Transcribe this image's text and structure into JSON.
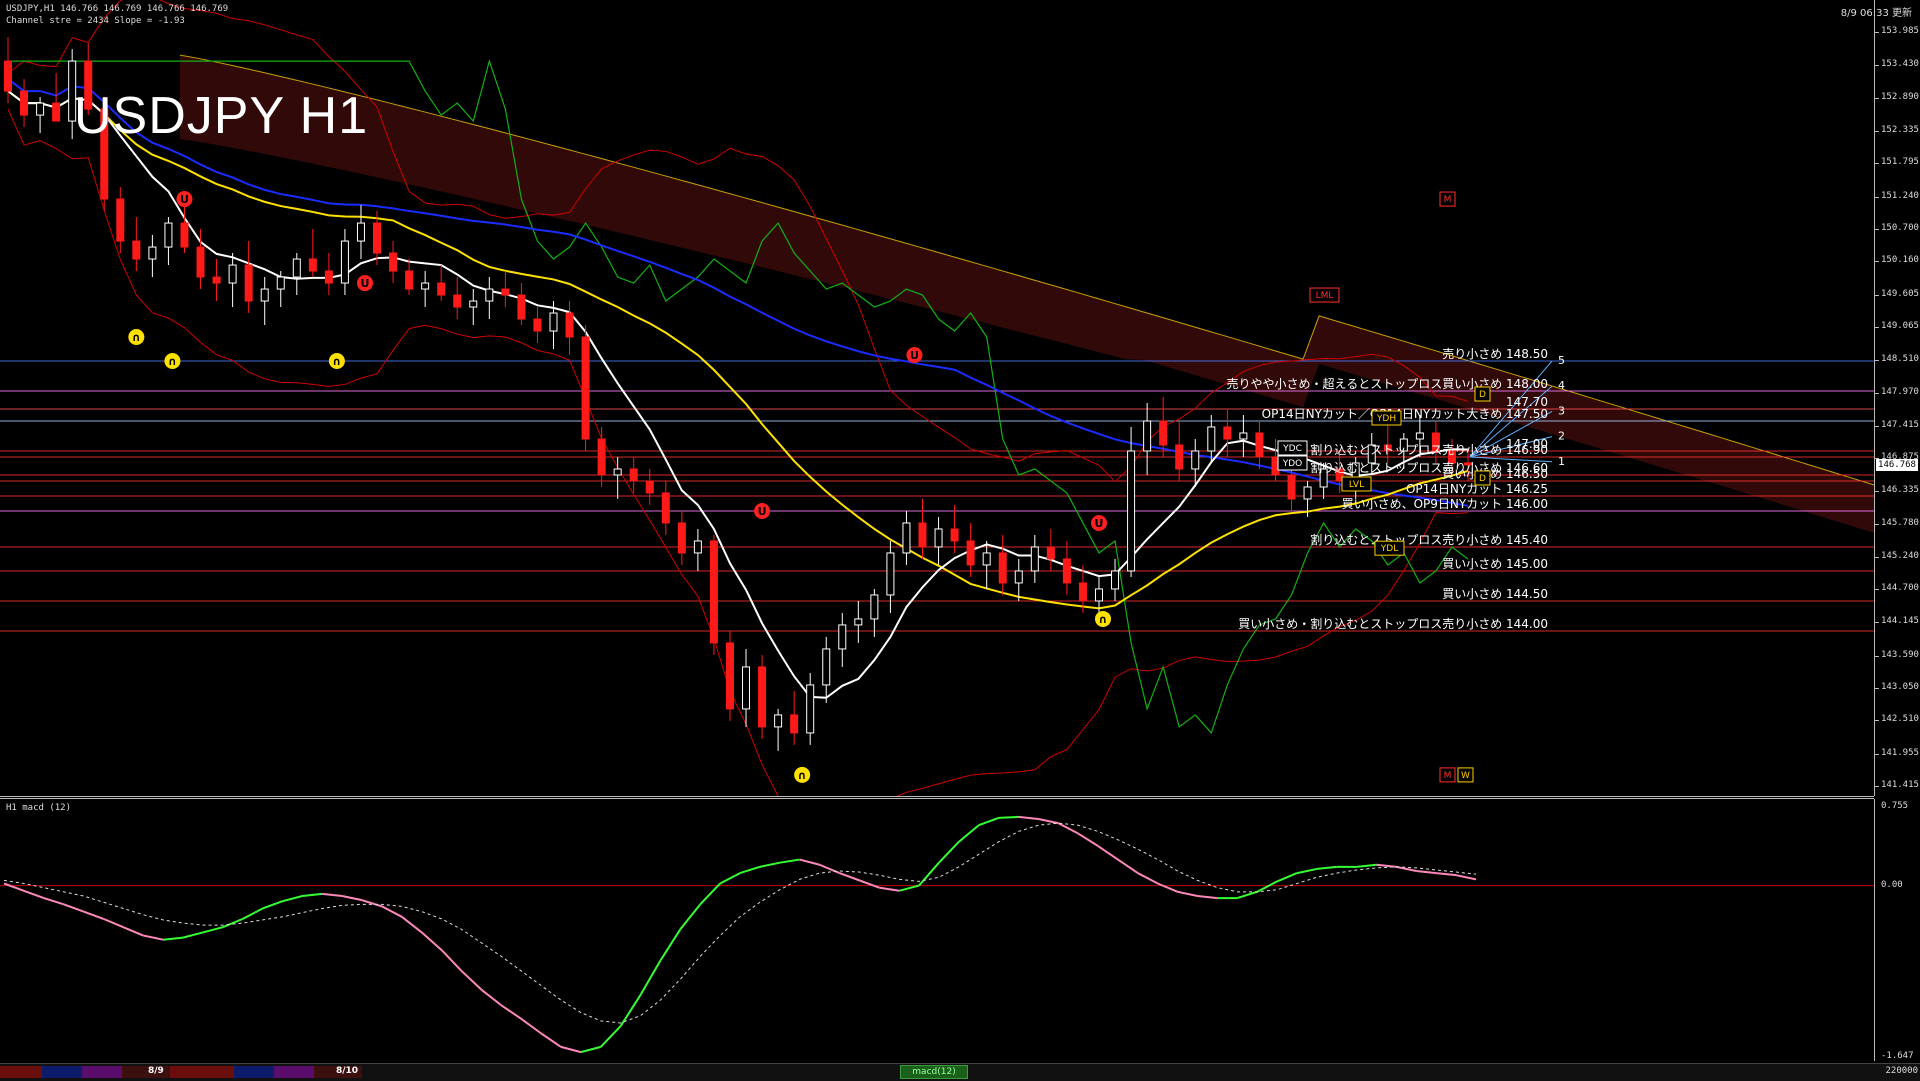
{
  "header": {
    "info_line": "USDJPY,H1  146.766 146.769 146.766 146.769",
    "channel_line": "Channel stre = 2434 Slope = -1.93",
    "datetime": "8/9 06:33 更新",
    "big_title": "USDJPY H1"
  },
  "price_axis": {
    "ticks": [
      "153.985",
      "153.430",
      "152.890",
      "152.335",
      "151.795",
      "151.240",
      "150.700",
      "150.160",
      "149.605",
      "149.065",
      "148.510",
      "147.970",
      "147.415",
      "146.875",
      "146.335",
      "145.780",
      "145.240",
      "144.700",
      "144.145",
      "143.590",
      "143.050",
      "142.510",
      "141.955",
      "141.415"
    ],
    "current_price": "146.768"
  },
  "macd_axis": {
    "ticks": [
      "0.755",
      "0.00",
      "-1.647"
    ]
  },
  "macd_label": "H1  macd (12)",
  "levels": [
    {
      "text": "売り小さめ 148.50",
      "price": 148.5,
      "color": "#4b7bff"
    },
    {
      "text": "売りやや小さめ・超えるとストップロス買い小さめ 148.00",
      "price": 148.0,
      "color": "#ff7fff"
    },
    {
      "text": "147.70",
      "price": 147.7,
      "color": "#ff5050"
    },
    {
      "text": "OP14日NYカット／OP14日NYカット大きめ 147.50",
      "price": 147.5,
      "color": "#aaccff"
    },
    {
      "text": "147.00",
      "price": 147.0,
      "color": "#ff3030"
    },
    {
      "text": "割り込むとストップロス売り小さめ 146.90",
      "price": 146.9,
      "color": "#ff3030"
    },
    {
      "text": "割り込むとストップロス売り小さめ 146.60",
      "price": 146.6,
      "color": "#ff3030"
    },
    {
      "text": "買い小さめ 146.50",
      "price": 146.5,
      "color": "#ff3030"
    },
    {
      "text": "OP14日NYカット 146.25",
      "price": 146.25,
      "color": "#ff3030"
    },
    {
      "text": "買い小さめ、OP9日NYカット 146.00",
      "price": 146.0,
      "color": "#ff7fff"
    },
    {
      "text": "割り込むとストップロス売り小さめ 145.40",
      "price": 145.4,
      "color": "#ff3030"
    },
    {
      "text": "買い小さめ 145.00",
      "price": 145.0,
      "color": "#ff3030"
    },
    {
      "text": "買い小さめ 144.50",
      "price": 144.5,
      "color": "#ff3030"
    },
    {
      "text": "買い小さめ・割り込むとストップロス売り小さめ 144.00",
      "price": 144.0,
      "color": "#ff3030"
    }
  ],
  "tags": [
    {
      "text": "M",
      "price": 151.2,
      "color": "#ff3030"
    },
    {
      "text": "LML",
      "price": 149.6,
      "color": "#ff3030"
    },
    {
      "text": "YDH",
      "price": 147.55,
      "color": "#ffd000"
    },
    {
      "text": "YDC",
      "price": 147.05,
      "color": "#ffffff"
    },
    {
      "text": "YDO",
      "price": 146.8,
      "color": "#ffffff"
    },
    {
      "text": "LVL",
      "price": 146.45,
      "color": "#ffd000"
    },
    {
      "text": "YDL",
      "price": 145.38,
      "color": "#ffd000"
    },
    {
      "text": "M",
      "price": 141.6,
      "color": "#ff3030"
    },
    {
      "text": "W",
      "price": 141.6,
      "color": "#ffd000"
    },
    {
      "text": "D",
      "price": 147.95,
      "color": "#ffd000"
    },
    {
      "text": "D",
      "price": 146.55,
      "color": "#ffd000"
    }
  ],
  "fan_numbers": [
    "5",
    "4",
    "3",
    "2",
    "1"
  ],
  "bottom_strip": {
    "dates": [
      "8/9",
      "8/10"
    ],
    "macd_tab": "macd(12)",
    "right_text": "220000"
  },
  "chart_data": {
    "type": "candlestick",
    "title": "USDJPY H1",
    "ylim": [
      141.415,
      153.985
    ],
    "candles": [
      [
        153.5,
        153.9,
        152.8,
        153.0
      ],
      [
        153.0,
        153.2,
        152.4,
        152.6
      ],
      [
        152.6,
        152.9,
        152.3,
        152.8
      ],
      [
        152.8,
        153.3,
        152.5,
        152.5
      ],
      [
        152.5,
        153.7,
        152.2,
        153.5
      ],
      [
        153.5,
        153.8,
        152.6,
        152.7
      ],
      [
        152.7,
        152.9,
        151.0,
        151.2
      ],
      [
        151.2,
        151.4,
        150.3,
        150.5
      ],
      [
        150.5,
        150.9,
        150.0,
        150.2
      ],
      [
        150.2,
        150.6,
        149.9,
        150.4
      ],
      [
        150.4,
        150.9,
        150.1,
        150.8
      ],
      [
        150.8,
        151.1,
        150.3,
        150.4
      ],
      [
        150.4,
        150.7,
        149.7,
        149.9
      ],
      [
        149.9,
        150.2,
        149.5,
        149.8
      ],
      [
        149.8,
        150.3,
        149.4,
        150.1
      ],
      [
        150.1,
        150.5,
        149.3,
        149.5
      ],
      [
        149.5,
        149.9,
        149.1,
        149.7
      ],
      [
        149.7,
        150.0,
        149.4,
        149.9
      ],
      [
        149.9,
        150.3,
        149.6,
        150.2
      ],
      [
        150.2,
        150.7,
        149.9,
        150.0
      ],
      [
        150.0,
        150.3,
        149.6,
        149.8
      ],
      [
        149.8,
        150.7,
        149.6,
        150.5
      ],
      [
        150.5,
        151.1,
        150.2,
        150.8
      ],
      [
        150.8,
        151.0,
        150.1,
        150.3
      ],
      [
        150.3,
        150.5,
        149.8,
        150.0
      ],
      [
        150.0,
        150.2,
        149.6,
        149.7
      ],
      [
        149.7,
        150.0,
        149.4,
        149.8
      ],
      [
        149.8,
        150.1,
        149.5,
        149.6
      ],
      [
        149.6,
        149.9,
        149.2,
        149.4
      ],
      [
        149.4,
        149.7,
        149.1,
        149.5
      ],
      [
        149.5,
        149.9,
        149.2,
        149.7
      ],
      [
        149.7,
        150.0,
        149.4,
        149.6
      ],
      [
        149.6,
        149.8,
        149.1,
        149.2
      ],
      [
        149.2,
        149.4,
        148.8,
        149.0
      ],
      [
        149.0,
        149.5,
        148.7,
        149.3
      ],
      [
        149.3,
        149.5,
        148.6,
        148.9
      ],
      [
        148.9,
        149.1,
        147.0,
        147.2
      ],
      [
        147.2,
        147.4,
        146.4,
        146.6
      ],
      [
        146.6,
        146.9,
        146.2,
        146.7
      ],
      [
        146.7,
        146.9,
        146.3,
        146.5
      ],
      [
        146.5,
        146.7,
        146.1,
        146.3
      ],
      [
        146.3,
        146.5,
        145.6,
        145.8
      ],
      [
        145.8,
        146.0,
        145.1,
        145.3
      ],
      [
        145.3,
        145.7,
        145.0,
        145.5
      ],
      [
        145.5,
        145.6,
        143.6,
        143.8
      ],
      [
        143.8,
        144.0,
        142.5,
        142.7
      ],
      [
        142.7,
        143.7,
        142.4,
        143.4
      ],
      [
        143.4,
        143.6,
        142.2,
        142.4
      ],
      [
        142.4,
        142.7,
        142.0,
        142.6
      ],
      [
        142.6,
        143.0,
        142.1,
        142.3
      ],
      [
        142.3,
        143.3,
        142.1,
        143.1
      ],
      [
        143.1,
        143.9,
        142.8,
        143.7
      ],
      [
        143.7,
        144.3,
        143.4,
        144.1
      ],
      [
        144.1,
        144.5,
        143.8,
        144.2
      ],
      [
        144.2,
        144.7,
        143.9,
        144.6
      ],
      [
        144.6,
        145.5,
        144.3,
        145.3
      ],
      [
        145.3,
        146.0,
        145.1,
        145.8
      ],
      [
        145.8,
        146.2,
        145.2,
        145.4
      ],
      [
        145.4,
        145.9,
        145.1,
        145.7
      ],
      [
        145.7,
        146.1,
        145.3,
        145.5
      ],
      [
        145.5,
        145.8,
        144.9,
        145.1
      ],
      [
        145.1,
        145.5,
        144.7,
        145.3
      ],
      [
        145.3,
        145.6,
        144.6,
        144.8
      ],
      [
        144.8,
        145.2,
        144.5,
        145.0
      ],
      [
        145.0,
        145.6,
        144.8,
        145.4
      ],
      [
        145.4,
        145.7,
        145.0,
        145.2
      ],
      [
        145.2,
        145.5,
        144.6,
        144.8
      ],
      [
        144.8,
        145.1,
        144.3,
        144.5
      ],
      [
        144.5,
        144.9,
        144.3,
        144.7
      ],
      [
        144.7,
        145.2,
        144.5,
        145.0
      ],
      [
        145.0,
        147.4,
        144.9,
        147.0
      ],
      [
        147.0,
        147.8,
        146.6,
        147.5
      ],
      [
        147.5,
        147.9,
        146.9,
        147.1
      ],
      [
        147.1,
        147.5,
        146.5,
        146.7
      ],
      [
        146.7,
        147.2,
        146.4,
        147.0
      ],
      [
        147.0,
        147.6,
        146.8,
        147.4
      ],
      [
        147.4,
        147.7,
        146.9,
        147.2
      ],
      [
        147.2,
        147.6,
        146.9,
        147.3
      ],
      [
        147.3,
        147.5,
        146.7,
        146.9
      ],
      [
        146.9,
        147.2,
        146.5,
        146.6
      ],
      [
        146.6,
        146.9,
        146.0,
        146.2
      ],
      [
        146.2,
        146.5,
        145.9,
        146.4
      ],
      [
        146.4,
        146.8,
        146.2,
        146.7
      ],
      [
        146.7,
        147.0,
        146.3,
        146.5
      ],
      [
        146.5,
        146.9,
        146.2,
        146.8
      ],
      [
        146.8,
        147.3,
        146.6,
        147.1
      ],
      [
        147.1,
        147.5,
        146.8,
        147.0
      ],
      [
        147.0,
        147.3,
        146.7,
        147.2
      ],
      [
        147.2,
        147.6,
        146.9,
        147.3
      ],
      [
        147.3,
        147.5,
        146.8,
        147.0
      ],
      [
        147.0,
        147.2,
        146.6,
        146.8
      ],
      [
        146.8,
        147.0,
        146.5,
        146.77
      ]
    ],
    "macd": [
      0.02,
      -0.05,
      -0.12,
      -0.18,
      -0.25,
      -0.32,
      -0.4,
      -0.48,
      -0.52,
      -0.5,
      -0.45,
      -0.4,
      -0.32,
      -0.22,
      -0.15,
      -0.1,
      -0.08,
      -0.1,
      -0.14,
      -0.2,
      -0.3,
      -0.45,
      -0.62,
      -0.82,
      -1.0,
      -1.15,
      -1.28,
      -1.42,
      -1.55,
      -1.6,
      -1.55,
      -1.35,
      -1.05,
      -0.72,
      -0.42,
      -0.18,
      0.02,
      0.12,
      0.18,
      0.22,
      0.25,
      0.2,
      0.12,
      0.05,
      -0.02,
      -0.05,
      0.0,
      0.22,
      0.42,
      0.58,
      0.65,
      0.66,
      0.64,
      0.6,
      0.5,
      0.38,
      0.25,
      0.12,
      0.02,
      -0.06,
      -0.1,
      -0.12,
      -0.12,
      -0.06,
      0.04,
      0.12,
      0.16,
      0.18,
      0.18,
      0.2,
      0.18,
      0.14,
      0.12,
      0.1,
      0.06
    ],
    "signal": [
      0.05,
      0.02,
      -0.02,
      -0.06,
      -0.1,
      -0.16,
      -0.22,
      -0.28,
      -0.33,
      -0.36,
      -0.38,
      -0.38,
      -0.36,
      -0.33,
      -0.3,
      -0.26,
      -0.22,
      -0.19,
      -0.18,
      -0.18,
      -0.2,
      -0.25,
      -0.32,
      -0.42,
      -0.55,
      -0.68,
      -0.82,
      -0.96,
      -1.1,
      -1.22,
      -1.3,
      -1.32,
      -1.25,
      -1.1,
      -0.9,
      -0.68,
      -0.48,
      -0.3,
      -0.16,
      -0.04,
      0.06,
      0.12,
      0.14,
      0.13,
      0.1,
      0.06,
      0.04,
      0.08,
      0.18,
      0.3,
      0.42,
      0.52,
      0.58,
      0.6,
      0.58,
      0.52,
      0.44,
      0.35,
      0.25,
      0.14,
      0.05,
      -0.02,
      -0.06,
      -0.06,
      -0.04,
      0.02,
      0.08,
      0.12,
      0.15,
      0.17,
      0.18,
      0.17,
      0.15,
      0.13,
      0.11
    ],
    "macd_ylim": [
      -1.647,
      0.755
    ]
  }
}
